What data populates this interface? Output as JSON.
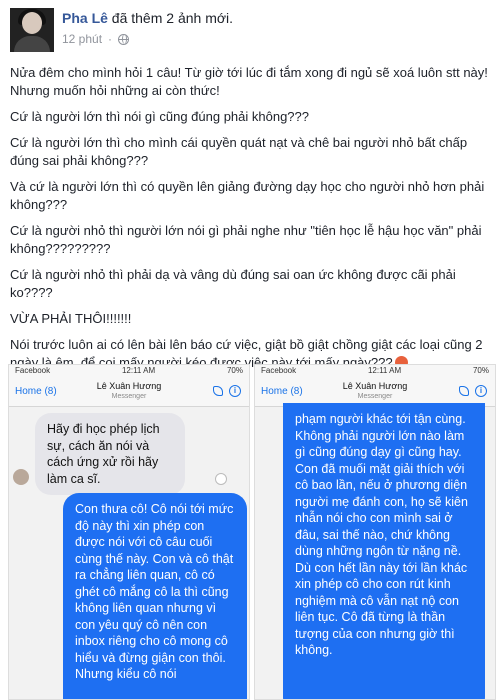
{
  "post": {
    "author": "Pha Lê",
    "action": "đã thêm 2 ảnh mới.",
    "time": "12 phút",
    "paragraphs": [
      "Nửa đêm cho mình hỏi 1 câu! Từ giờ tới lúc đi tắm xong đi ngủ sẽ xoá luôn stt này! Nhưng muốn hỏi những ai còn thức!",
      "Cứ là người lớn thì nói gì cũng đúng phải không???",
      "Cứ là người lớn thì cho mình cái quyền quát nạt và chê bai người nhỏ bất chấp đúng sai phải không???",
      "Và cứ là người lớn thì có quyền lên giảng đường dạy học cho người nhỏ hơn phải không???",
      "Cứ là người nhỏ thì người lớn nói gì phải nghe như \"tiên học lễ hậu học văn\" phải không?????????",
      "Cứ là người nhỏ thì phải dạ và vâng dù đúng sai oan ức không được cãi phải ko????",
      "VỪA PHẢI THÔI!!!!!!!",
      "Nói trước luôn ai có lên bài lên báo cứ việc, giật bồ giật chồng giật các loại cũng 2 ngày là êm, để coi mấy người kéo được việc này tới mấy ngày???"
    ]
  },
  "photos": {
    "left": {
      "carrier": "Facebook",
      "clock": "12:11 AM",
      "battery": "70%",
      "back_label": "Home (8)",
      "contact": "Lê Xuân Hương",
      "contact_sub": "Messenger",
      "received": "Hãy đi học phép lịch sự, cách ăn nói và cách ứng xử rồi hãy làm ca sĩ.",
      "sent": "Con thưa cô! Cô nói tới mức độ này thì xin phép con được nói với cô câu cuối cùng thế này. Con và cô thật ra chẳng liên quan, cô có ghét cô mắng cô la thì cũng không liên quan nhưng vì con yêu quý cô nên con inbox riêng cho cô mong cô hiểu và đừng giận con thôi. Nhưng kiểu cô nói"
    },
    "right": {
      "carrier": "Facebook",
      "clock": "12:11 AM",
      "battery": "70%",
      "back_label": "Home (8)",
      "contact": "Lê Xuân Hương",
      "contact_sub": "Messenger",
      "sent": "phạm người khác tới tận cùng. Không phải người lớn nào làm gì cũng đúng dạy gì cũng hay. Con đã muối mặt giải thích với cô bao lần, nếu ở phương diện người mẹ đánh con, họ sẽ kiên nhẫn nói cho con mình sai ở đâu, sai thế nào, chứ không dùng những ngôn từ nặng nề. Dù con hết lần này tới lần khác xin phép cô cho con rút kinh nghiệm mà cô vẫn nạt nộ con liên tục. Cô đã từng là thần tượng của con nhưng giờ thì không."
    }
  },
  "colors": {
    "author_link": "#365899",
    "bubble_blue": "#1e6ff2",
    "bubble_gray": "#e5e5ea"
  },
  "icons": [
    "globe-icon",
    "angry-face-icon",
    "phone-icon",
    "info-icon"
  ]
}
